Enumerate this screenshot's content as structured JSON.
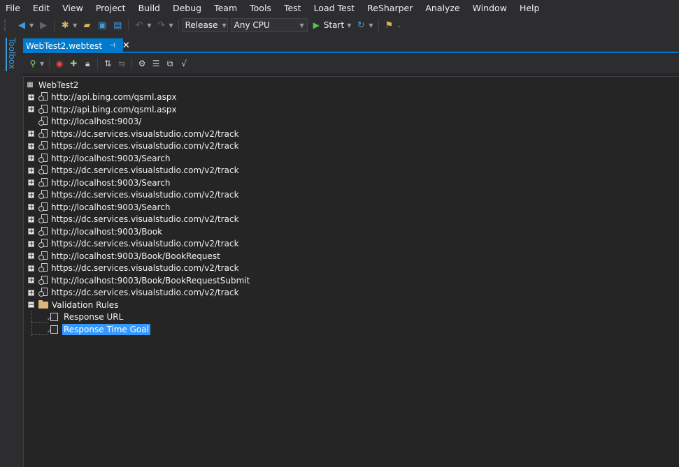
{
  "menu": [
    "File",
    "Edit",
    "View",
    "Project",
    "Build",
    "Debug",
    "Team",
    "Tools",
    "Test",
    "Load Test",
    "ReSharper",
    "Analyze",
    "Window",
    "Help"
  ],
  "toolbar": {
    "configuration": "Release",
    "platform": "Any CPU",
    "start_label": "Start"
  },
  "toolbox": {
    "label": "Toolbox"
  },
  "document_tab": {
    "title": "WebTest2.webtest"
  },
  "tree": {
    "root": "WebTest2",
    "requests": [
      {
        "url": "http://api.bing.com/qsml.aspx",
        "expandable": true
      },
      {
        "url": "http://api.bing.com/qsml.aspx",
        "expandable": true
      },
      {
        "url": "http://localhost:9003/",
        "expandable": false
      },
      {
        "url": "https://dc.services.visualstudio.com/v2/track",
        "expandable": true
      },
      {
        "url": "https://dc.services.visualstudio.com/v2/track",
        "expandable": true
      },
      {
        "url": "http://localhost:9003/Search",
        "expandable": true
      },
      {
        "url": "https://dc.services.visualstudio.com/v2/track",
        "expandable": true
      },
      {
        "url": "http://localhost:9003/Search",
        "expandable": true
      },
      {
        "url": "https://dc.services.visualstudio.com/v2/track",
        "expandable": true
      },
      {
        "url": "http://localhost:9003/Search",
        "expandable": true
      },
      {
        "url": "https://dc.services.visualstudio.com/v2/track",
        "expandable": true
      },
      {
        "url": "http://localhost:9003/Book",
        "expandable": true
      },
      {
        "url": "https://dc.services.visualstudio.com/v2/track",
        "expandable": true
      },
      {
        "url": "http://localhost:9003/Book/BookRequest",
        "expandable": true
      },
      {
        "url": "https://dc.services.visualstudio.com/v2/track",
        "expandable": true
      },
      {
        "url": "http://localhost:9003/Book/BookRequestSubmit",
        "expandable": true
      },
      {
        "url": "https://dc.services.visualstudio.com/v2/track",
        "expandable": true
      }
    ],
    "validation_folder": "Validation Rules",
    "rules": [
      {
        "label": "Response URL",
        "selected": false
      },
      {
        "label": "Response Time Goal",
        "selected": true
      }
    ]
  },
  "colors": {
    "accent": "#007acc",
    "selection": "#3399ff",
    "background": "#252526",
    "chrome": "#2d2d30"
  }
}
